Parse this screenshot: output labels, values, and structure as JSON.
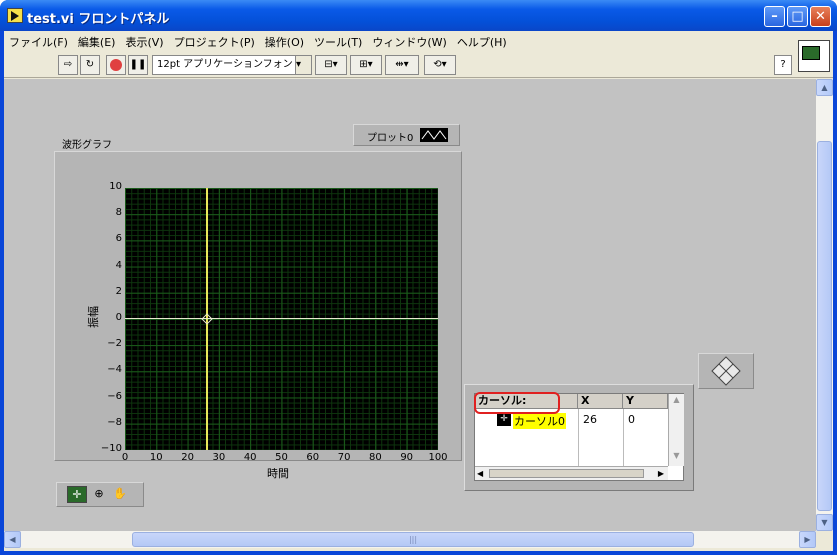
{
  "window": {
    "title": "test.vi フロントパネル"
  },
  "menu": [
    "ファイル(F)",
    "編集(E)",
    "表示(V)",
    "プロジェクト(P)",
    "操作(O)",
    "ツール(T)",
    "ウィンドウ(W)",
    "ヘルプ(H)"
  ],
  "toolbar": {
    "font": "12pt アプリケーションフォント",
    "help": "?"
  },
  "graph": {
    "label": "波形グラフ",
    "plot_legend": "プロット0",
    "xlabel": "時間",
    "ylabel": "振幅",
    "yticks": [
      "10",
      "8",
      "6",
      "4",
      "2",
      "0",
      "−2",
      "−4",
      "−6",
      "−8",
      "−10"
    ],
    "xticks": [
      "0",
      "10",
      "20",
      "30",
      "40",
      "50",
      "60",
      "70",
      "80",
      "90",
      "100"
    ]
  },
  "cursor": {
    "header": "カーソル:",
    "col_x": "X",
    "col_y": "Y",
    "name": "カーソル0",
    "x": "26",
    "y": "0"
  },
  "colors": {
    "plot_bg": "#000000",
    "grid": "#1a5a1a",
    "cursor_line": "#e8e85a",
    "highlight": "#e02020"
  }
}
